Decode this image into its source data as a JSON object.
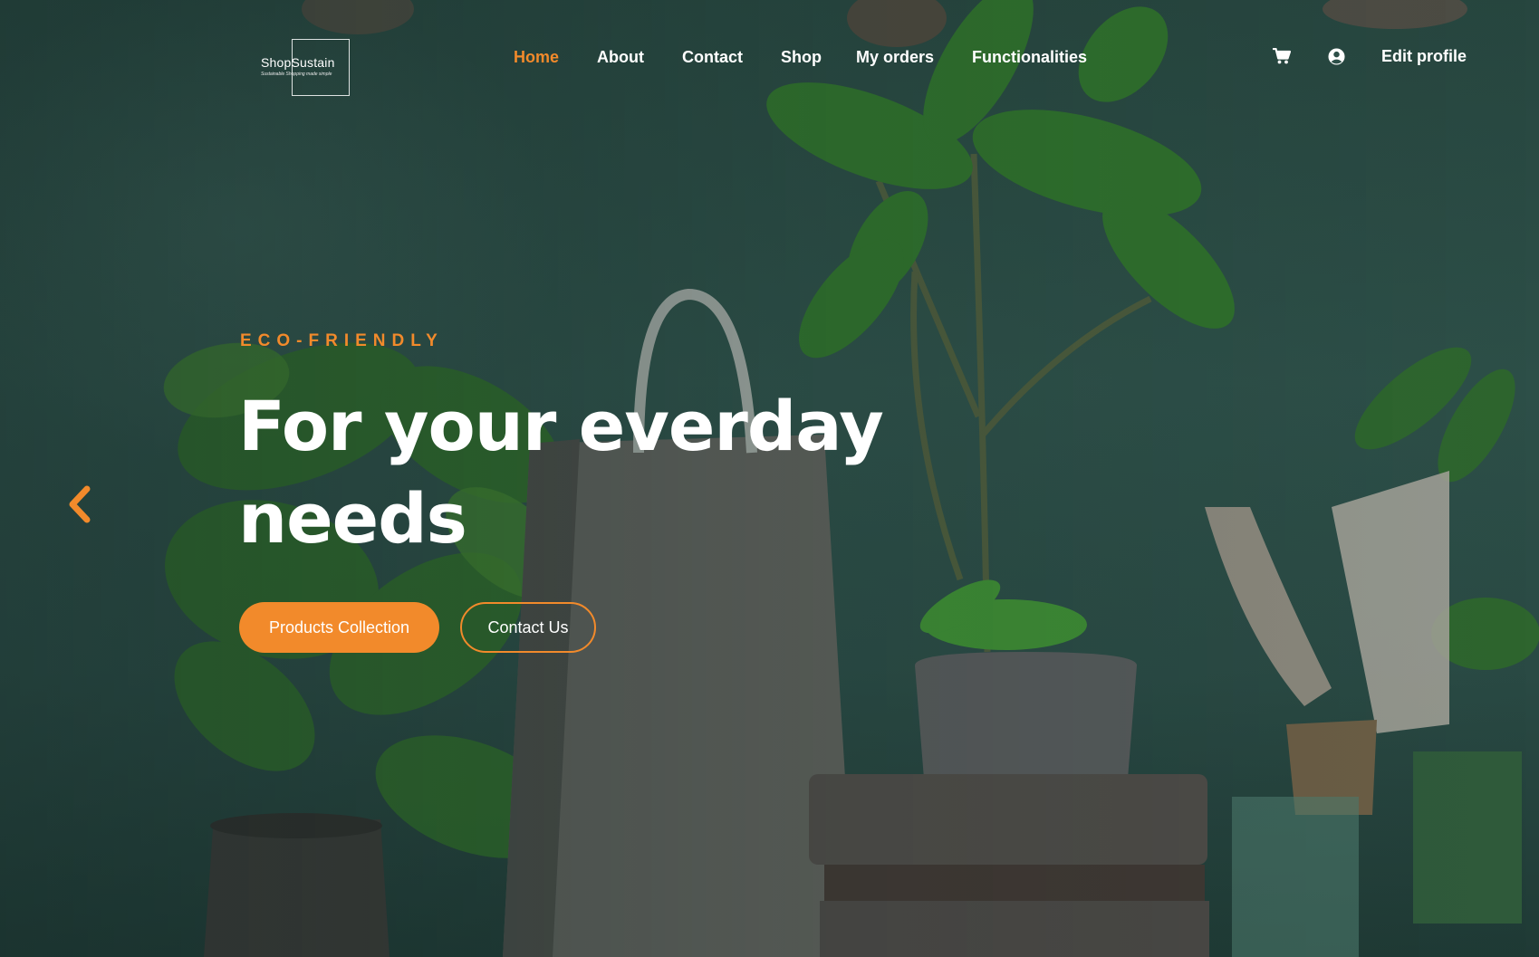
{
  "brand": {
    "name": "ShopSustain",
    "tagline": "Sustainable Shopping made simple"
  },
  "nav": {
    "items": [
      {
        "label": "Home",
        "active": true
      },
      {
        "label": "About",
        "active": false
      },
      {
        "label": "Contact",
        "active": false
      },
      {
        "label": "Shop",
        "active": false
      },
      {
        "label": "My orders",
        "active": false
      },
      {
        "label": "Functionalities",
        "active": false
      }
    ]
  },
  "header": {
    "cart_icon": "cart-icon",
    "user_icon": "user-circle-icon",
    "edit_profile_label": "Edit profile"
  },
  "hero": {
    "kicker": "ECO-FRIENDLY",
    "headline": "For your everday needs",
    "primary_button": "Products Collection",
    "secondary_button": "Contact Us",
    "prev_icon": "chevron-left-icon"
  },
  "colors": {
    "accent": "#f28a2b",
    "text": "#ffffff",
    "background": "#2d4f48"
  }
}
